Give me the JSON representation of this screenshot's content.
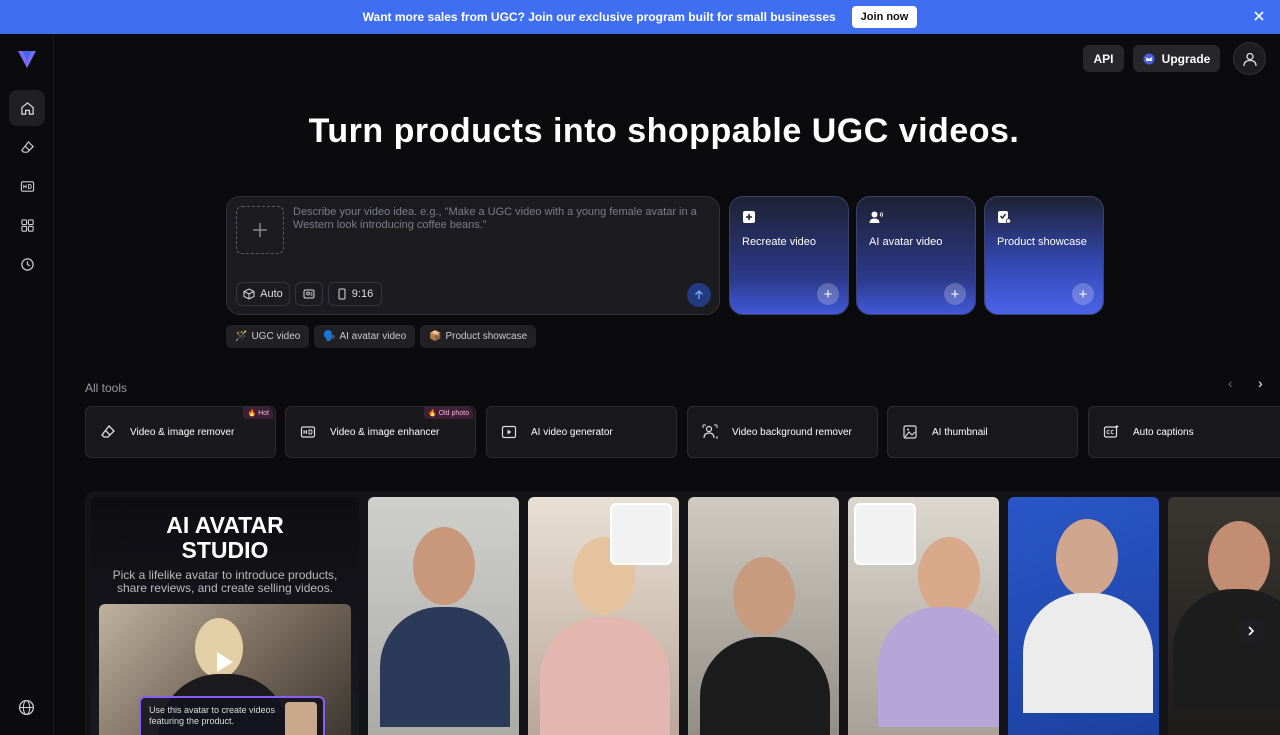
{
  "banner": {
    "message": "Want more sales from UGC? Join our exclusive program built for small businesses",
    "cta": "Join now"
  },
  "header": {
    "api_label": "API",
    "upgrade_label": "Upgrade"
  },
  "hero": {
    "title": "Turn products into shoppable UGC videos."
  },
  "prompt": {
    "placeholder": "Describe your video idea. e.g., \"Make a UGC video with a young female avatar in a Western look introducing coffee beans.\"",
    "auto_label": "Auto",
    "ratio_label": "9:16"
  },
  "modes": [
    {
      "label": "Recreate video"
    },
    {
      "label": "AI avatar video"
    },
    {
      "label": "Product showcase"
    }
  ],
  "quick_picks": [
    {
      "emoji": "🪄",
      "label": "UGC video"
    },
    {
      "emoji": "🗣️",
      "label": "AI avatar video"
    },
    {
      "emoji": "📦",
      "label": "Product showcase"
    }
  ],
  "tools_section": {
    "label": "All tools",
    "items": [
      {
        "label": "Video & image remover",
        "tag": "🔥 Hot"
      },
      {
        "label": "Video & image enhancer",
        "tag": "🔥 Old photo"
      },
      {
        "label": "AI video generator",
        "tag": ""
      },
      {
        "label": "Video background remover",
        "tag": ""
      },
      {
        "label": "AI thumbnail",
        "tag": ""
      },
      {
        "label": "Auto captions",
        "tag": ""
      }
    ]
  },
  "gallery": {
    "studio_title_1": "AI AVATAR",
    "studio_title_2": "STUDIO",
    "studio_subtitle": "Pick a lifelike avatar to introduce products, share reviews, and create selling videos.",
    "studio_note": "Use this avatar to create videos featuring the product."
  },
  "colors": {
    "banner": "#3f6ff0",
    "accent": "#4a5fe0",
    "card_gradient_top": "#1e2233",
    "card_gradient_bottom": "#4258d8"
  }
}
